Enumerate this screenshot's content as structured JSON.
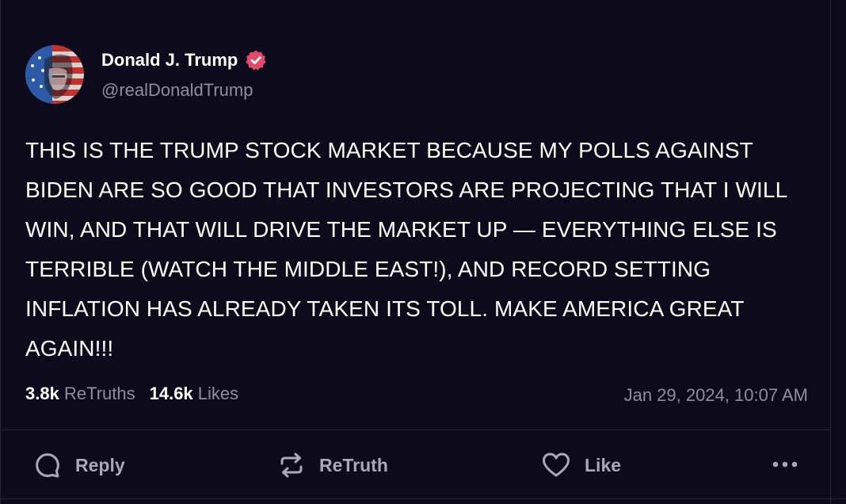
{
  "author": {
    "display_name": "Donald J. Trump",
    "handle": "@realDonaldTrump",
    "verified_icon": "verified-badge-icon",
    "avatar": "avatar"
  },
  "post": {
    "text": "THIS IS THE TRUMP STOCK MARKET BECAUSE MY POLLS AGAINST BIDEN ARE SO GOOD THAT INVESTORS ARE PROJECTING THAT I WILL WIN, AND THAT WILL DRIVE THE MARKET UP — EVERYTHING ELSE IS TERRIBLE (WATCH THE MIDDLE EAST!), AND RECORD SETTING INFLATION HAS ALREADY TAKEN ITS TOLL. MAKE AMERICA GREAT AGAIN!!!"
  },
  "stats": {
    "retruths_count": "3.8k",
    "retruths_label": "ReTruths",
    "likes_count": "14.6k",
    "likes_label": "Likes"
  },
  "timestamp": "Jan 29, 2024, 10:07 AM",
  "actions": {
    "reply": {
      "label": "Reply",
      "icon": "reply-icon"
    },
    "retruth": {
      "label": "ReTruth",
      "icon": "retruth-icon"
    },
    "like": {
      "label": "Like",
      "icon": "heart-icon"
    },
    "more": {
      "icon": "more-dots-icon"
    }
  },
  "colors": {
    "background": "#0d0b1b",
    "text": "#ffffff",
    "muted": "#8f8d9e",
    "action": "#a9a7b8",
    "border": "#26233a",
    "verified_badge": "#e24a6a"
  }
}
